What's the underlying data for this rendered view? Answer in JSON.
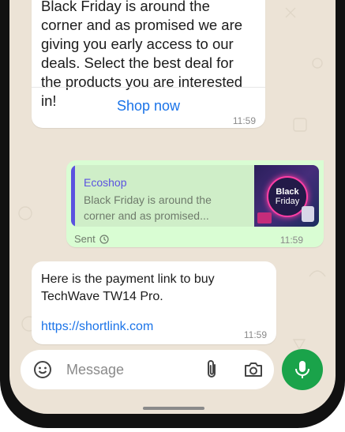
{
  "messages": [
    {
      "body": "Black Friday is around the corner and as promised we are giving you early access to our deals. Select the best deal for the products you are interested in!",
      "cta_label": "Shop now",
      "time": "11:59"
    },
    {
      "quoted_name": "Ecoshop",
      "quoted_text": "Black Friday is around the corner and as promised...",
      "thumbnail_text_1": "Black",
      "thumbnail_text_2": "Friday",
      "status": "Sent",
      "time": "11:59"
    },
    {
      "body": "Here is the payment link to buy TechWave TW14 Pro.",
      "link": "https://shortlink.com",
      "time": "11:59"
    }
  ],
  "composer": {
    "placeholder": "Message"
  },
  "colors": {
    "accent_link": "#1a73e8",
    "send_green": "#1aa34a",
    "outgoing_bubble": "#d9fdd3",
    "quote_accent": "#5b52e0"
  },
  "icons": {
    "emoji": "emoji-icon",
    "attach": "paperclip-icon",
    "camera": "camera-icon",
    "mic": "mic-icon",
    "sent": "clock-icon"
  }
}
